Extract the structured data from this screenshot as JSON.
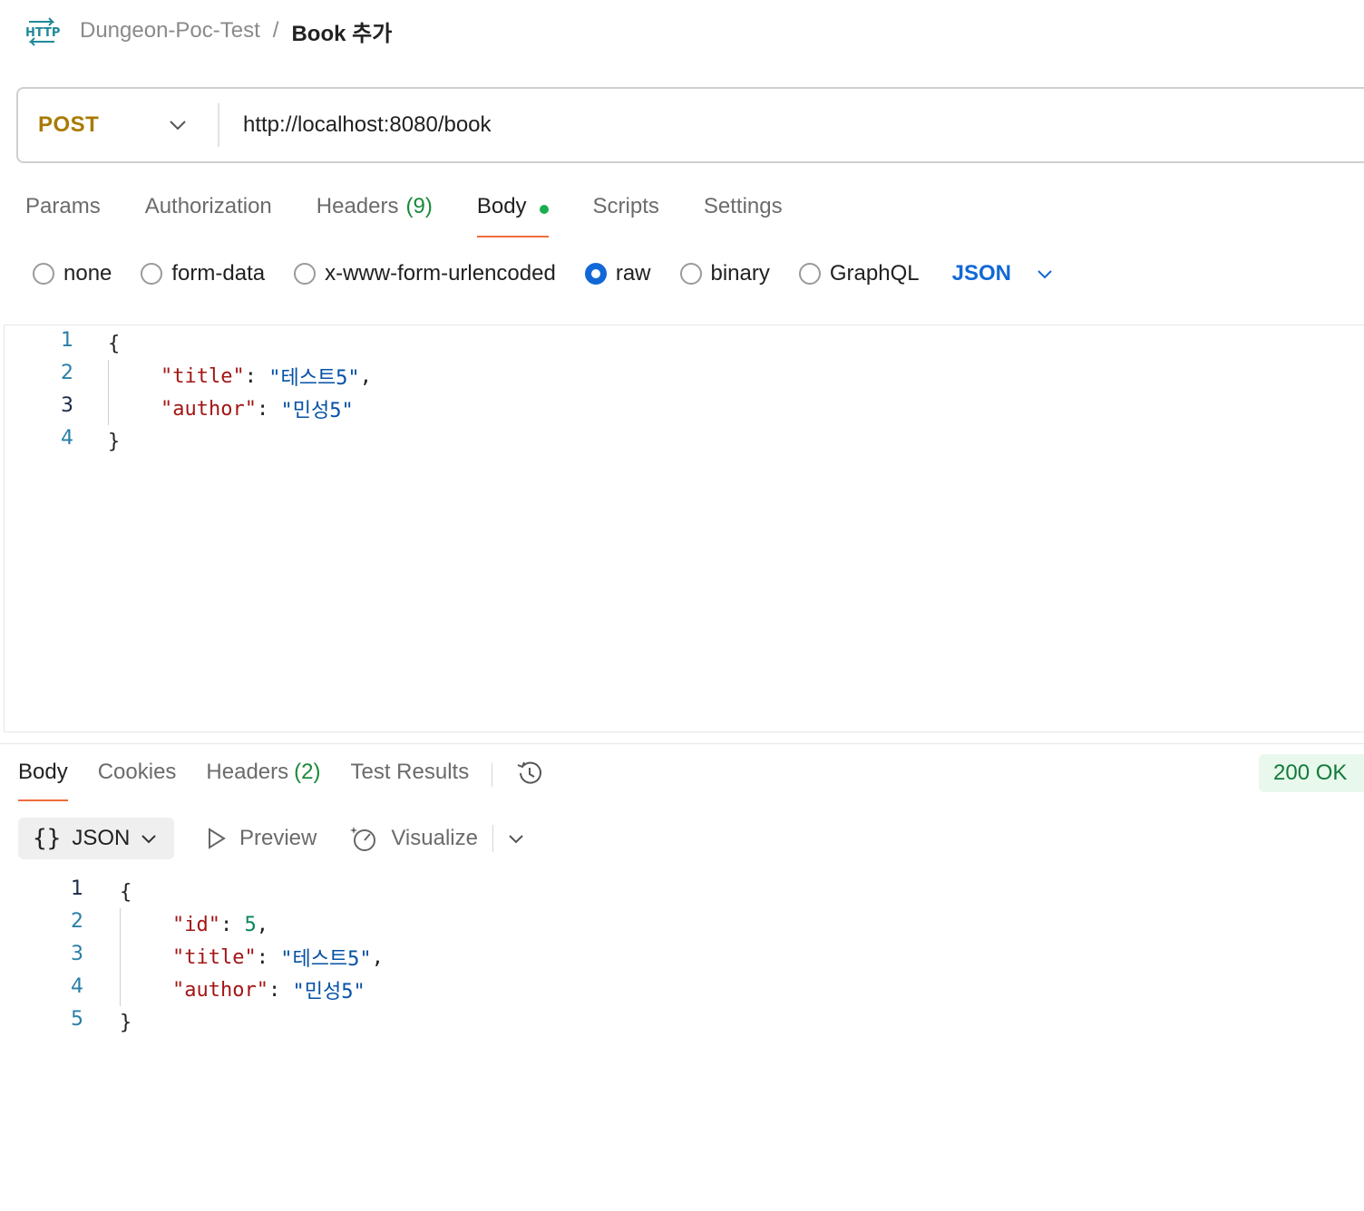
{
  "breadcrumb": {
    "icon": "http-icon",
    "parent": "Dungeon-Poc-Test",
    "separator": "/",
    "current": "Book 추가"
  },
  "request": {
    "method": "POST",
    "url": "http://localhost:8080/book",
    "tabs": [
      {
        "label": "Params"
      },
      {
        "label": "Authorization"
      },
      {
        "label": "Headers",
        "count": "(9)"
      },
      {
        "label": "Body",
        "active": true,
        "indicator": true
      },
      {
        "label": "Scripts"
      },
      {
        "label": "Settings"
      }
    ],
    "body_options": [
      {
        "label": "none",
        "selected": false
      },
      {
        "label": "form-data",
        "selected": false
      },
      {
        "label": "x-www-form-urlencoded",
        "selected": false
      },
      {
        "label": "raw",
        "selected": true
      },
      {
        "label": "binary",
        "selected": false
      },
      {
        "label": "GraphQL",
        "selected": false
      }
    ],
    "language": "JSON",
    "editor_lines": [
      "1",
      "2",
      "3",
      "4"
    ],
    "body": {
      "open": "{",
      "close": "}",
      "title_key": "\"title\"",
      "title_value": "\"테스트5\"",
      "author_key": "\"author\"",
      "author_value": "\"민성5\""
    }
  },
  "response": {
    "tabs": [
      {
        "label": "Body",
        "active": true
      },
      {
        "label": "Cookies"
      },
      {
        "label": "Headers",
        "count": "(2)"
      },
      {
        "label": "Test Results"
      }
    ],
    "status": "200 OK",
    "format": {
      "braces": "{}",
      "label": "JSON"
    },
    "preview_label": "Preview",
    "visualize_label": "Visualize",
    "editor_lines": [
      "1",
      "2",
      "3",
      "4",
      "5"
    ],
    "body": {
      "open": "{",
      "close": "}",
      "id_key": "\"id\"",
      "id_value": "5",
      "title_key": "\"title\"",
      "title_value": "\"테스트5\"",
      "author_key": "\"author\"",
      "author_value": "\"민성5\""
    }
  }
}
